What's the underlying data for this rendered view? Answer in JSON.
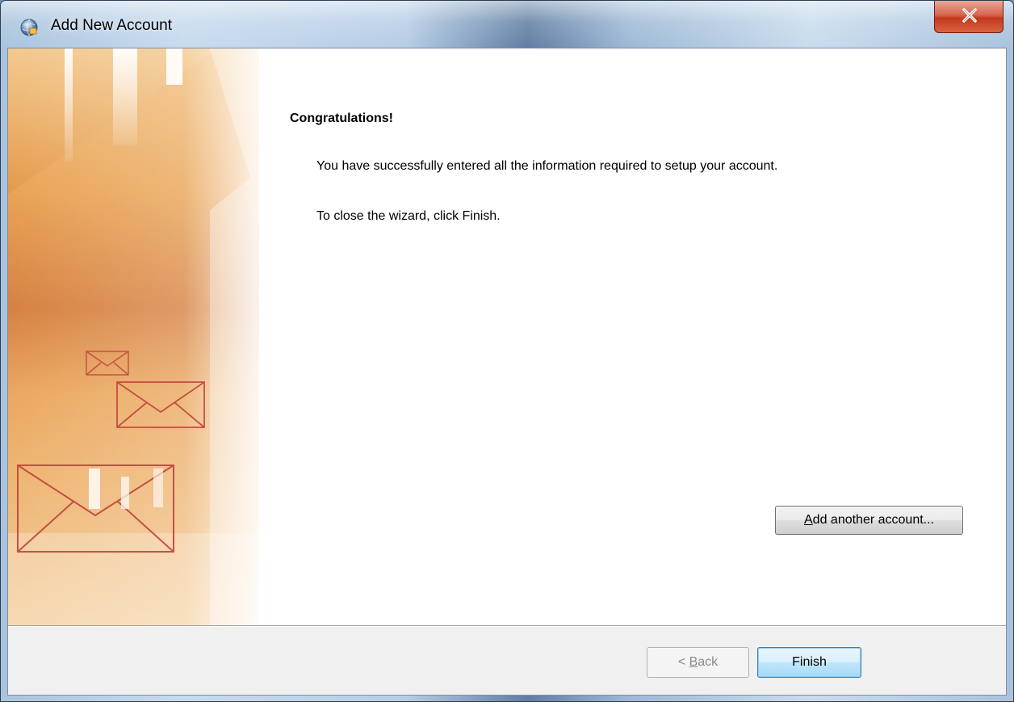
{
  "window": {
    "title": "Add New Account",
    "close_label": "X"
  },
  "content": {
    "heading": "Congratulations!",
    "message_success": "You have successfully entered all the information required to setup your account.",
    "message_close": "To close the wizard, click Finish."
  },
  "buttons": {
    "add_another_account": {
      "mnemonic": "A",
      "rest": "dd another account..."
    },
    "back": {
      "prefix": "< ",
      "mnemonic": "B",
      "rest": "ack",
      "enabled": false
    },
    "finish": {
      "label": "Finish",
      "default": true
    }
  },
  "colors": {
    "accent_orange": "#e07a2c",
    "close_red": "#c2381f",
    "default_button_border": "#3c7fb1"
  },
  "icons": {
    "app": "outlook-globe-icon",
    "art": "envelope-icon"
  }
}
